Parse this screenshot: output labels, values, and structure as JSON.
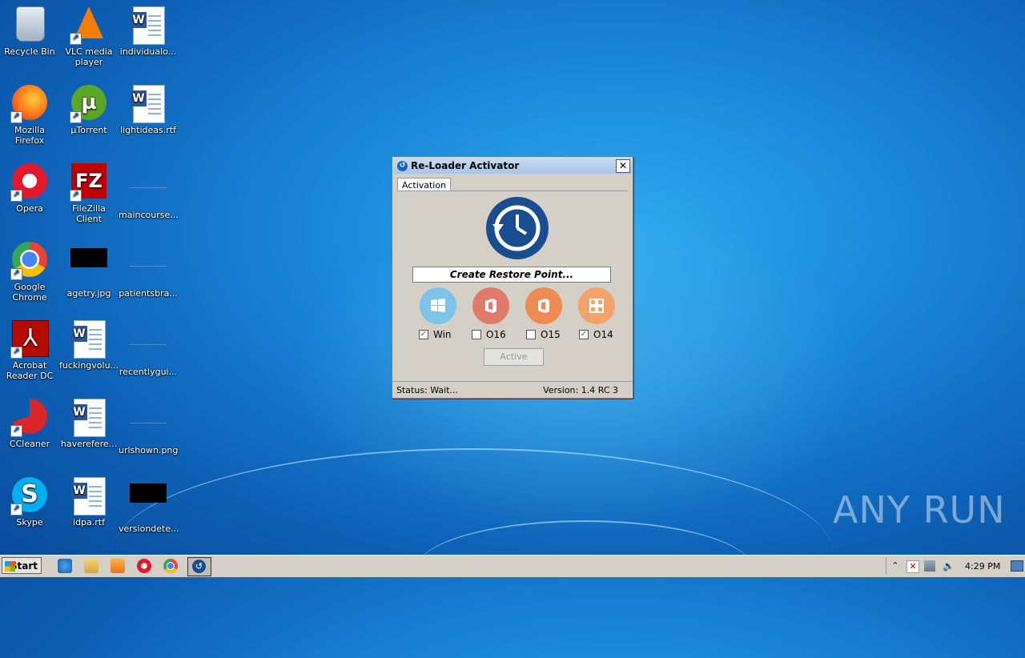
{
  "desktop": {
    "icons": [
      {
        "label": "Recycle Bin"
      },
      {
        "label": "VLC media player"
      },
      {
        "label": "individualo..."
      },
      {
        "label": "Mozilla Firefox"
      },
      {
        "label": "µTorrent"
      },
      {
        "label": "lightideas.rtf"
      },
      {
        "label": "Opera"
      },
      {
        "label": "FileZilla Client"
      },
      {
        "label": "maincourse..."
      },
      {
        "label": "Google Chrome"
      },
      {
        "label": "agetry.jpg"
      },
      {
        "label": "patientsbra..."
      },
      {
        "label": "Acrobat Reader DC"
      },
      {
        "label": "fuckingvolu..."
      },
      {
        "label": "recentlygui..."
      },
      {
        "label": "CCleaner"
      },
      {
        "label": "haverefere..."
      },
      {
        "label": "urlshown.png"
      },
      {
        "label": "Skype"
      },
      {
        "label": "idpa.rtf"
      },
      {
        "label": "versiondete..."
      }
    ]
  },
  "dialog": {
    "title": "Re-Loader Activator",
    "close_glyph": "✕",
    "tab": "Activation",
    "restore_text": "Create Restore Point...",
    "options": [
      {
        "label": "Win",
        "checked": true
      },
      {
        "label": "O16",
        "checked": false
      },
      {
        "label": "O15",
        "checked": false
      },
      {
        "label": "O14",
        "checked": true
      }
    ],
    "active_button": "Active",
    "status": "Status: Wait...",
    "version": "Version: 1.4 RC 3"
  },
  "taskbar": {
    "start_label": "Start",
    "clock": "4:29 PM"
  },
  "watermark": "ANY RUN",
  "colors": {
    "win": "#7cc3e8",
    "o16": "#e07a6a",
    "o15": "#ee8a52",
    "o14": "#f2a36a",
    "restore": "#1a4d8f"
  }
}
